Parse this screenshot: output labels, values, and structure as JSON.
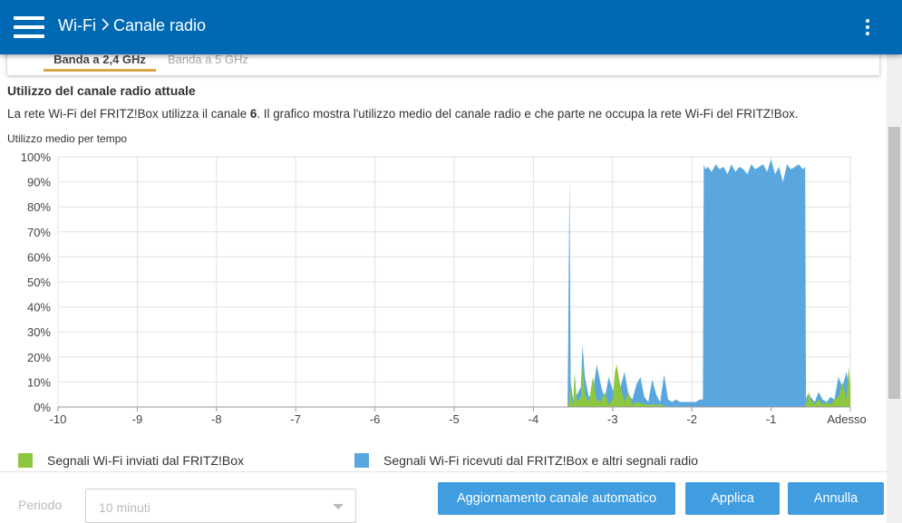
{
  "header": {
    "breadcrumb_parent": "Wi-Fi",
    "breadcrumb_current": "Canale radio",
    "menu_icon": "hamburger-icon",
    "more_icon": "vertical-ellipsis-icon",
    "background_color": "#0069b4"
  },
  "tabs": [
    {
      "label": "Banda a 2,4 GHz",
      "active": true
    },
    {
      "label": "Banda a 5 GHz",
      "active": false
    }
  ],
  "content": {
    "title": "Utilizzo del canale radio attuale",
    "description_prefix": "La rete Wi-Fi del FRITZ!Box utilizza il canale ",
    "channel": "6",
    "description_suffix": ". Il grafico mostra l'utilizzo medio del canale radio e che parte ne occupa la rete Wi-Fi del FRITZ!Box.",
    "chart_caption": "Utilizzo medio per tempo"
  },
  "chart_data": {
    "type": "area",
    "title": "Utilizzo medio per tempo",
    "xlim": [
      -10,
      0
    ],
    "ylim": [
      0,
      100
    ],
    "x_ticks": [
      "-10",
      "-9",
      "-8",
      "-7",
      "-6",
      "-5",
      "-4",
      "-3",
      "-2",
      "-1",
      "Adesso"
    ],
    "y_ticks": [
      "0%",
      "10%",
      "20%",
      "30%",
      "40%",
      "50%",
      "60%",
      "70%",
      "80%",
      "90%",
      "100%"
    ],
    "grid": true,
    "series": [
      {
        "name": "Segnali Wi-Fi ricevuti dal FRITZ!Box e altri segnali radio",
        "color": "#5aa7e0",
        "x": [
          -10,
          -3.57,
          -3.56,
          -3.545,
          -3.53,
          -3.5,
          -3.45,
          -3.4,
          -3.38,
          -3.35,
          -3.3,
          -3.25,
          -3.2,
          -3.15,
          -3.1,
          -3.05,
          -3.0,
          -2.95,
          -2.9,
          -2.85,
          -2.8,
          -2.75,
          -2.7,
          -2.65,
          -2.6,
          -2.55,
          -2.5,
          -2.45,
          -2.4,
          -2.35,
          -2.3,
          -2.25,
          -2.2,
          -2.15,
          -2.1,
          -2.05,
          -2.0,
          -1.95,
          -1.9,
          -1.86,
          -1.85,
          -1.83,
          -1.8,
          -1.75,
          -1.7,
          -1.65,
          -1.6,
          -1.55,
          -1.5,
          -1.45,
          -1.4,
          -1.35,
          -1.3,
          -1.25,
          -1.2,
          -1.15,
          -1.1,
          -1.05,
          -1.0,
          -0.95,
          -0.9,
          -0.85,
          -0.8,
          -0.75,
          -0.7,
          -0.65,
          -0.6,
          -0.57,
          -0.56,
          -0.54,
          -0.5,
          -0.45,
          -0.4,
          -0.35,
          -0.3,
          -0.25,
          -0.2,
          -0.15,
          -0.1,
          -0.05,
          0
        ],
        "y": [
          0,
          0,
          30,
          92,
          10,
          3,
          5,
          8,
          25,
          12,
          4,
          6,
          17,
          9,
          3,
          12,
          7,
          4,
          8,
          14,
          5,
          3,
          9,
          12,
          4,
          2,
          11,
          5,
          2,
          13,
          3,
          2,
          3,
          2,
          2,
          2,
          2,
          2,
          3,
          3,
          97,
          95,
          96,
          94,
          97,
          95,
          96,
          93,
          97,
          94,
          96,
          95,
          93,
          97,
          95,
          96,
          97,
          94,
          99,
          93,
          96,
          90,
          97,
          95,
          96,
          97,
          95,
          96,
          3,
          5,
          4,
          2,
          6,
          3,
          2,
          4,
          3,
          12,
          8,
          14,
          6
        ]
      },
      {
        "name": "Segnali Wi-Fi inviati dal FRITZ!Box",
        "color": "#8dc63f",
        "x": [
          -10,
          -3.57,
          -3.55,
          -3.54,
          -3.52,
          -3.5,
          -3.48,
          -3.45,
          -3.4,
          -3.38,
          -3.35,
          -3.3,
          -3.25,
          -3.2,
          -3.15,
          -3.1,
          -3.05,
          -3.0,
          -2.97,
          -2.95,
          -2.9,
          -2.85,
          -2.8,
          -2.75,
          -2.7,
          -2.6,
          -2.5,
          -2.4,
          -2.3,
          -0.58,
          -0.55,
          -0.52,
          -0.5,
          -0.45,
          -0.4,
          -0.35,
          -0.3,
          -0.25,
          -0.2,
          -0.15,
          -0.1,
          -0.05,
          -0.02,
          0
        ],
        "y": [
          0,
          0,
          2,
          10,
          3,
          1,
          14,
          2,
          4,
          16,
          5,
          2,
          12,
          3,
          2,
          6,
          1,
          3,
          14,
          17,
          8,
          2,
          6,
          1,
          2,
          1,
          1,
          1,
          0,
          0,
          2,
          6,
          3,
          1,
          3,
          1,
          2,
          1,
          3,
          4,
          10,
          3,
          16,
          8
        ]
      }
    ]
  },
  "legend": [
    {
      "label": "Segnali Wi-Fi inviati dal FRITZ!Box",
      "color": "#8dc63f"
    },
    {
      "label": "Segnali Wi-Fi ricevuti dal FRITZ!Box e altri segnali radio",
      "color": "#5aa7e0"
    }
  ],
  "footer": {
    "period_label": "Periodo",
    "period_value": "10 minuti",
    "auto_button": "Aggiornamento canale automatico",
    "apply_button": "Applica",
    "cancel_button": "Annulla",
    "button_color": "#3f9de0"
  }
}
